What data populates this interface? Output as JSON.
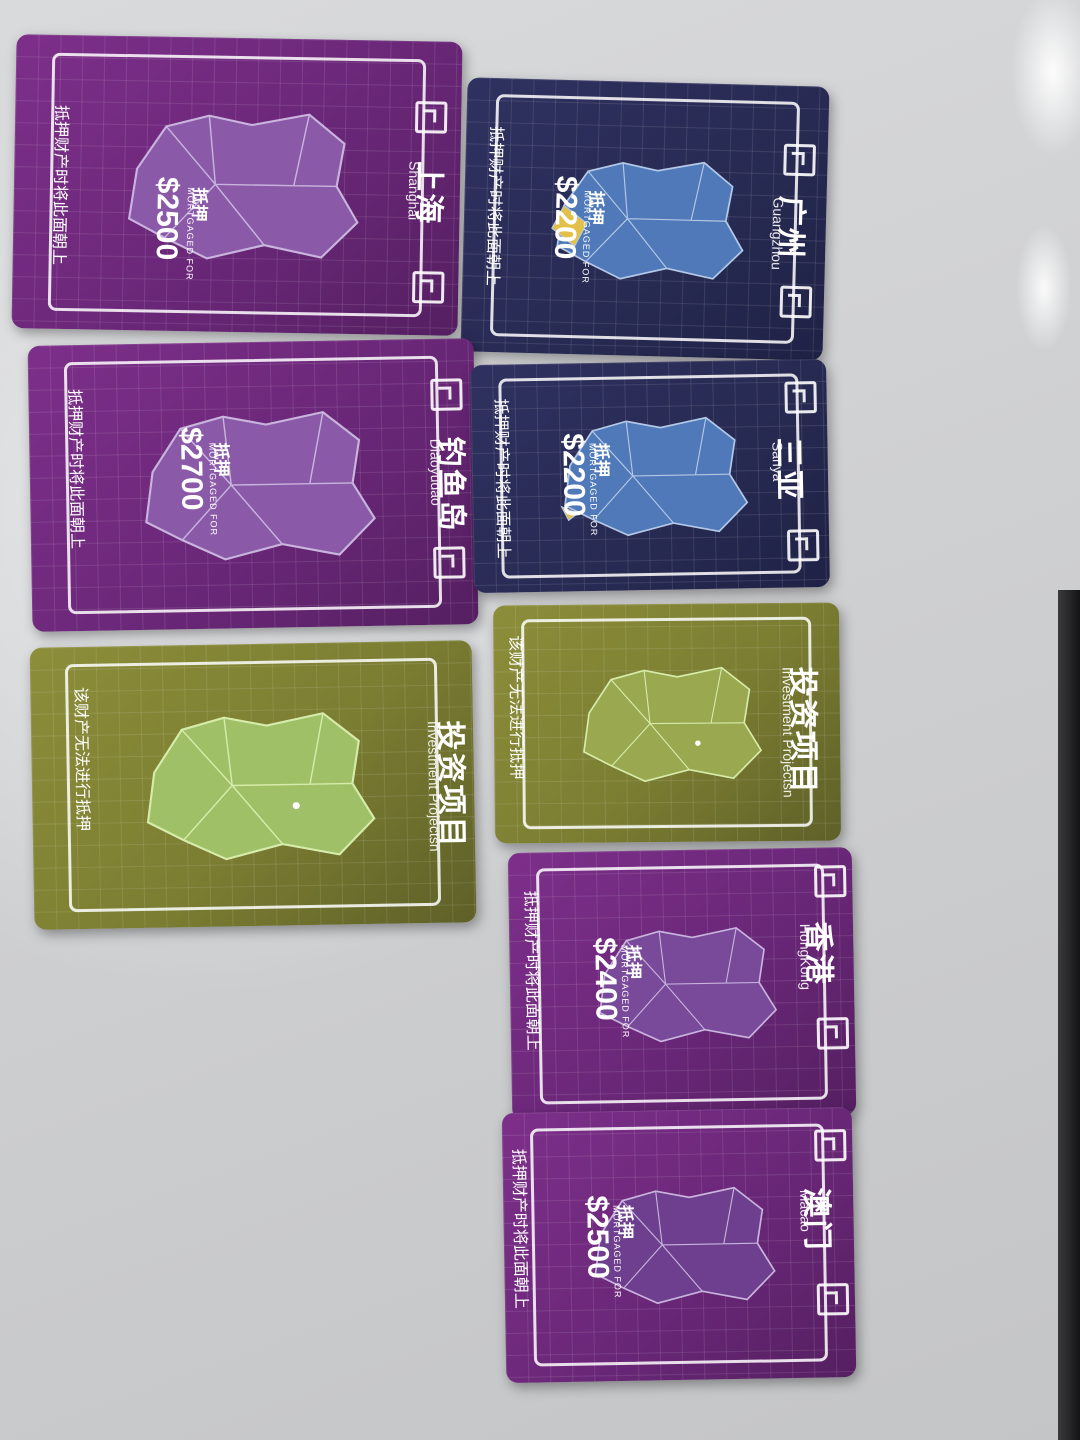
{
  "scene": {
    "description_colors": {
      "purple_card": "#6a2778",
      "navy_card": "#272a52",
      "olive_card": "#7b7d32",
      "map_purple": "#8a5aa8",
      "map_blue": "#4f79b8",
      "map_green": "#9fc067",
      "highlight_yellow": "#e3c04a"
    }
  },
  "cards": [
    {
      "city_zh": "上海",
      "city_en": "Shanghai",
      "mortgage_zh": "抵押",
      "mortgage_en": "MORTGAGED FOR",
      "price": "$2500",
      "note": "抵押财产时将此面朝上"
    },
    {
      "city_zh": "广州",
      "city_en": "Guangzhou",
      "mortgage_zh": "抵押",
      "mortgage_en": "MORTGAGED FOR",
      "price": "$2200",
      "note": "抵押财产时将此面朝上"
    },
    {
      "city_zh": "钓鱼岛",
      "city_en": "Diaoyudao",
      "mortgage_zh": "抵押",
      "mortgage_en": "MORTGAGED FOR",
      "price": "$2700",
      "note": "抵押财产时将此面朝上"
    },
    {
      "city_zh": "三亚",
      "city_en": "Sanya",
      "mortgage_zh": "抵押",
      "mortgage_en": "MORTGAGED FOR",
      "price": "$2200",
      "note": "抵押财产时将此面朝上"
    },
    {
      "city_zh": "投资项目",
      "city_en": "Investment Projectsn",
      "note": "该财产无法进行抵押"
    },
    {
      "city_zh": "投资项目",
      "city_en": "Investment Projectsn",
      "note": "该财产无法进行抵押"
    },
    {
      "city_zh": "香港",
      "city_en": "HongKong",
      "mortgage_zh": "抵押",
      "mortgage_en": "MORTGAGED FOR",
      "price": "$2400",
      "note": "抵押财产时将此面朝上"
    },
    {
      "city_zh": "澳门",
      "city_en": "Macao",
      "mortgage_zh": "抵押",
      "mortgage_en": "MORTGAGED FOR",
      "price": "$2500",
      "note": "抵押财产时将此面朝上"
    }
  ]
}
